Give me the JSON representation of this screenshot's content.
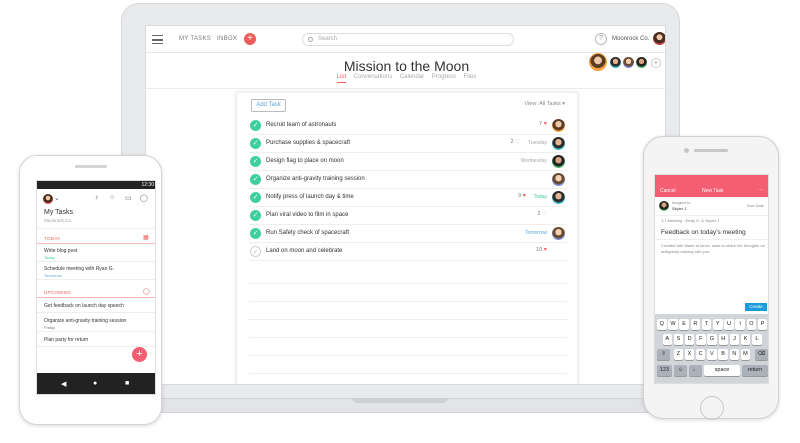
{
  "laptop": {
    "topbar": {
      "my_tasks": "MY TASKS",
      "inbox": "INBOX",
      "add": "+",
      "search_placeholder": "Search",
      "help": "?",
      "org_name": "Moonrock Co."
    },
    "project": {
      "title": "Mission to the Moon",
      "tabs": [
        "List",
        "Conversations",
        "Calendar",
        "Progress",
        "Files"
      ],
      "active_tab": "List",
      "add_member": "+"
    },
    "list": {
      "add_task_label": "Add Task",
      "view_label": "View: All Tasks",
      "tasks": [
        {
          "name": "Recruit team of astronauts",
          "count": "7",
          "meta": "",
          "done": true
        },
        {
          "name": "Purchase supplies & spacecraft",
          "count": "2",
          "meta": "Tuesday",
          "done": true
        },
        {
          "name": "Design flag to place on moon",
          "count": "",
          "meta": "Wednesday",
          "done": true
        },
        {
          "name": "Organize anti-gravity training session",
          "count": "",
          "meta": "",
          "done": true
        },
        {
          "name": "Notify press of launch day & time",
          "count": "9",
          "meta": "Today",
          "done": true
        },
        {
          "name": "Plan viral video to film in space",
          "count": "2",
          "meta": "",
          "done": true
        },
        {
          "name": "Run Safety check of spacecraft",
          "count": "",
          "meta": "Tomorrow",
          "done": true
        },
        {
          "name": "Land on moon and celebrate",
          "count": "10",
          "meta": "",
          "done": false
        }
      ]
    }
  },
  "android": {
    "status_time": "12:30",
    "title": "My Tasks",
    "subtitle": "Moonrock Co.",
    "today_label": "TODAY",
    "upcoming_label": "UPCOMING",
    "today_items": [
      {
        "name": "Write blog post",
        "due": "Today"
      },
      {
        "name": "Schedule meeting with Ryan G.",
        "due": "Tomorrow"
      }
    ],
    "upcoming_items": [
      {
        "name": "Get feedback on launch day speech",
        "due": ""
      },
      {
        "name": "Organize anti-gravity training session",
        "due": "Friday"
      },
      {
        "name": "Plan party for return",
        "due": ""
      }
    ],
    "fab": "+"
  },
  "iphone": {
    "cancel": "Cancel",
    "header_title": "New Task",
    "assigned_label": "Assigned to",
    "assignee": "Skyler J.",
    "due_label": "Due Date",
    "project_line": "1:1 Meeting - Emily K. & Skyler J.",
    "task_title": "Feedback on today's meeting",
    "description": "Created with Marie at lunch, want to share her thoughts on antigravity training with you.",
    "create": "Create",
    "keyboard": {
      "row1": [
        "Q",
        "W",
        "E",
        "R",
        "T",
        "Y",
        "U",
        "I",
        "O",
        "P"
      ],
      "row2": [
        "A",
        "S",
        "D",
        "F",
        "G",
        "H",
        "J",
        "K",
        "L"
      ],
      "row3": [
        "Z",
        "X",
        "C",
        "V",
        "B",
        "N",
        "M"
      ],
      "num": "123",
      "space": "space",
      "return": "return"
    }
  }
}
